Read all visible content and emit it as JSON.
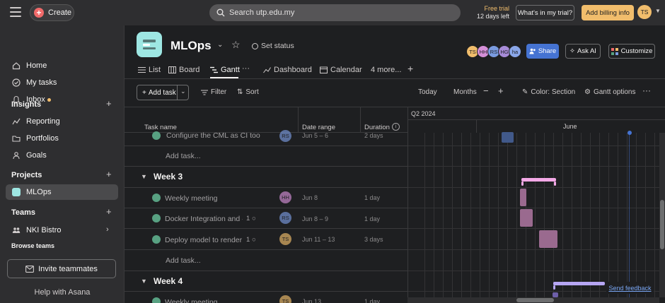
{
  "topbar": {
    "create_label": "Create",
    "search_placeholder": "Search utp.edu.my",
    "trial_line1": "Free trial",
    "trial_line2": "12 days left",
    "whats_label": "What's in my trial?",
    "billing_label": "Add billing info",
    "user_initials": "TS",
    "accent": "#f06a6a",
    "billing_color": "#f1bd6c"
  },
  "sidebar": {
    "nav": [
      {
        "label": "Home",
        "icon": "home-icon"
      },
      {
        "label": "My tasks",
        "icon": "check-circle-icon"
      },
      {
        "label": "Inbox",
        "icon": "bell-icon"
      }
    ],
    "insights_title": "Insights",
    "insights": [
      {
        "label": "Reporting",
        "icon": "chart-line-icon"
      },
      {
        "label": "Portfolios",
        "icon": "folder-icon"
      },
      {
        "label": "Goals",
        "icon": "person-icon"
      }
    ],
    "projects_title": "Projects",
    "projects": [
      {
        "label": "MLOps",
        "color": "#9ee7e3"
      }
    ],
    "teams_title": "Teams",
    "team": "NKI Bistro",
    "browse_teams": "Browse teams",
    "invite_label": "Invite teammates",
    "help_label": "Help with Asana"
  },
  "project": {
    "title": "MLOps",
    "set_status": "Set status",
    "members": [
      {
        "initials": "TS",
        "color": "#f1bd6c"
      },
      {
        "initials": "HH",
        "color": "#d58fd8"
      },
      {
        "initials": "RS",
        "color": "#7a9be0"
      },
      {
        "initials": "HG",
        "color": "#a78bd8"
      },
      {
        "initials": "ha",
        "color": "#8aa6e8"
      }
    ],
    "share_label": "Share",
    "askai_label": "Ask AI",
    "customize_label": "Customize",
    "tabs": [
      {
        "label": "List"
      },
      {
        "label": "Board"
      },
      {
        "label": "Gantt"
      },
      {
        "label": "Dashboard"
      },
      {
        "label": "Calendar"
      },
      {
        "label": "4 more..."
      }
    ]
  },
  "toolbar": {
    "add_task": "Add task",
    "filter": "Filter",
    "sort": "Sort",
    "today": "Today",
    "months": "Months",
    "color": "Color: Section",
    "gantt_options": "Gantt options"
  },
  "grid": {
    "col_task": "Task name",
    "col_date": "Date range",
    "col_duration": "Duration",
    "quarter": "Q2 2024",
    "month": "June",
    "add_task_row": "Add task...",
    "feedback": "Send feedback",
    "rows": [
      {
        "name": "Configure the CML as CI too",
        "assignee": "RS",
        "color": "#7a9be0",
        "date": "Jun 5 – 6",
        "duration": "2 days",
        "comments": ""
      },
      {
        "name": "Weekly meeting",
        "assignee": "HH",
        "color": "#d58fd8",
        "date": "Jun 8",
        "duration": "1 day",
        "comments": ""
      },
      {
        "name": "Docker Integration and ‹",
        "assignee": "RS",
        "color": "#7a9be0",
        "date": "Jun 8 – 9",
        "duration": "1 day",
        "comments": "1"
      },
      {
        "name": "Deploy model to render",
        "assignee": "TS",
        "color": "#f1bd6c",
        "date": "Jun 11 – 13",
        "duration": "3 days",
        "comments": "1"
      },
      {
        "name": "Weekly meeting",
        "assignee": "TS",
        "color": "#f1bd6c",
        "date": "Jun 13",
        "duration": "1 day",
        "comments": ""
      }
    ],
    "sections": [
      "Week 3",
      "Week 4"
    ]
  }
}
